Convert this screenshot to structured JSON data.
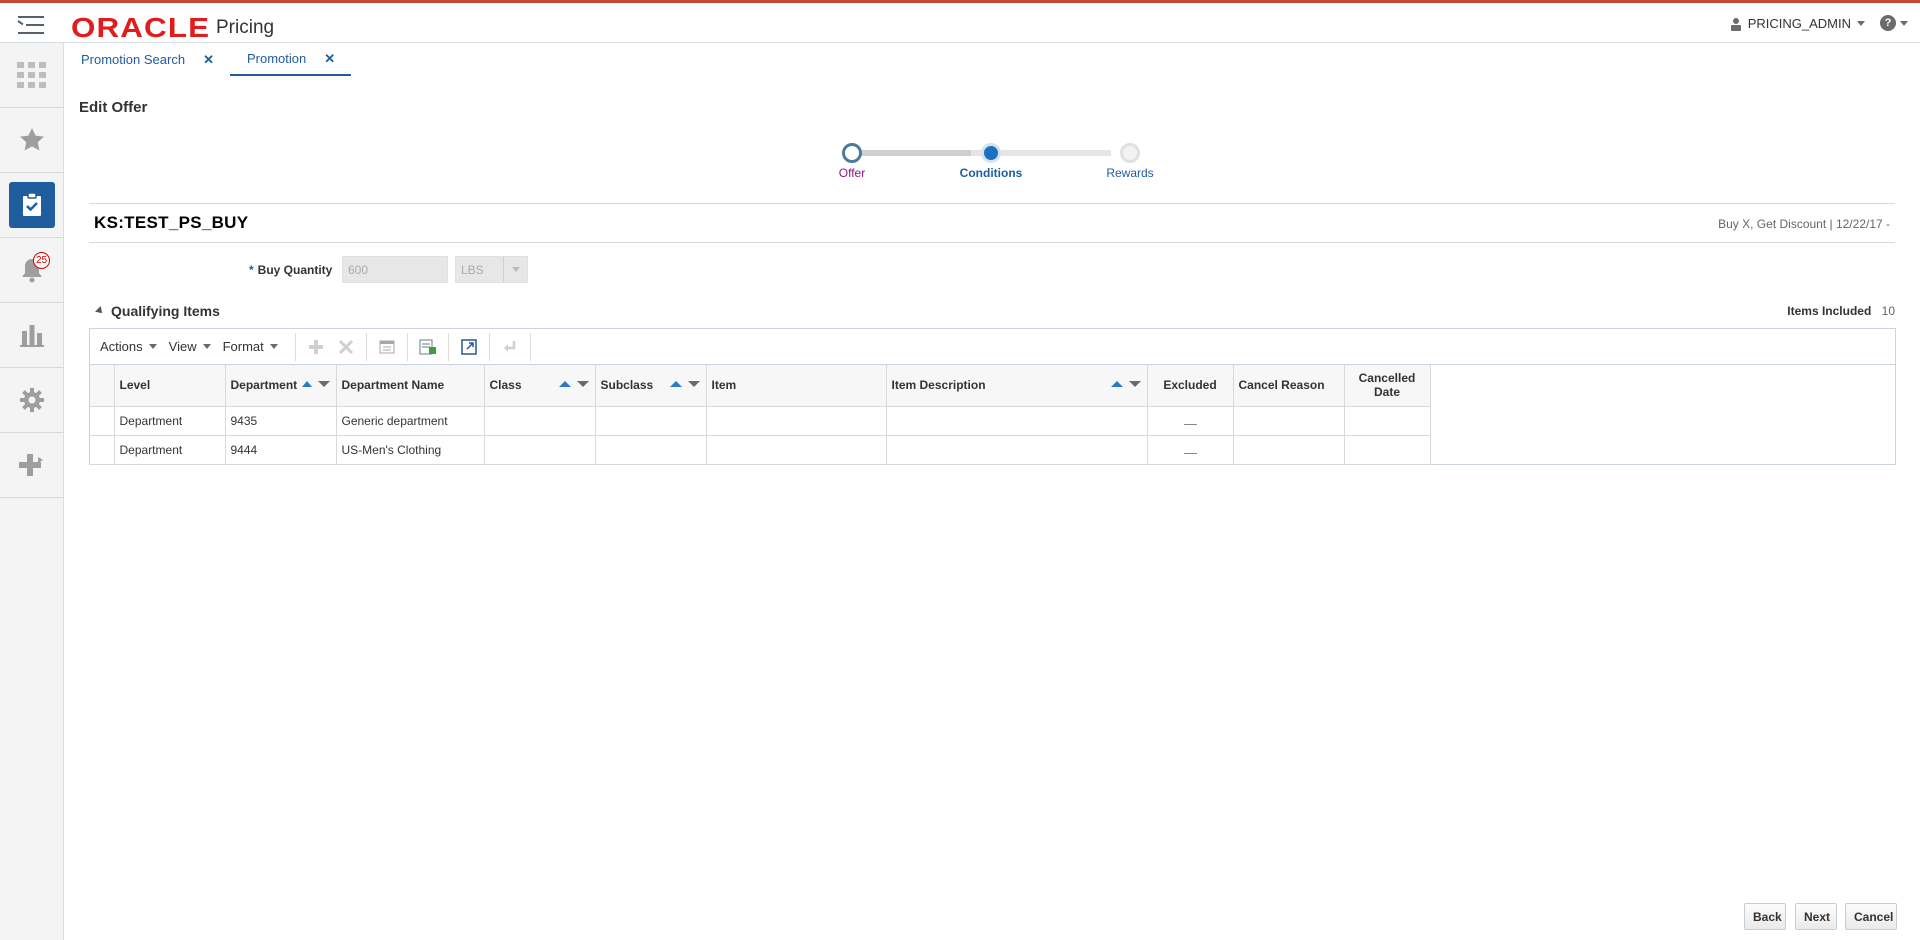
{
  "app": {
    "logo": "ORACLE",
    "product": "Pricing"
  },
  "user": {
    "name": "PRICING_ADMIN",
    "help": "?"
  },
  "nav": {
    "notifications_count": "25"
  },
  "tabs": [
    {
      "label": "Promotion Search"
    },
    {
      "label": "Promotion"
    }
  ],
  "page": {
    "title": "Edit Offer"
  },
  "train": {
    "steps": [
      {
        "label": "Offer"
      },
      {
        "label": "Conditions"
      },
      {
        "label": "Rewards"
      }
    ]
  },
  "offer": {
    "name": "KS:TEST_PS_BUY",
    "meta": "Buy X, Get Discount  |  12/22/17  -"
  },
  "buy_quantity": {
    "label": "Buy Quantity",
    "required_mark": "*",
    "value": "600",
    "uom": "LBS"
  },
  "qualifying_items": {
    "title": "Qualifying Items",
    "items_included_label": "Items Included",
    "items_included_value": "10",
    "toolbar": {
      "actions": "Actions",
      "view": "View",
      "format": "Format"
    },
    "columns": {
      "level": "Level",
      "department": "Department",
      "department_name": "Department Name",
      "class": "Class",
      "subclass": "Subclass",
      "item": "Item",
      "item_description": "Item Description",
      "excluded": "Excluded",
      "cancel_reason": "Cancel Reason",
      "cancelled_date": "Cancelled Date"
    },
    "rows": [
      {
        "level": "Department",
        "department": "9435",
        "department_name": "Generic department"
      },
      {
        "level": "Department",
        "department": "9444",
        "department_name": "US-Men's Clothing"
      }
    ]
  },
  "buttons": {
    "back": "Back",
    "next": "Next",
    "cancel": "Cancel"
  },
  "colors": {
    "brand_red": "#e01c1c",
    "accent_blue": "#1f5d9e",
    "offer_step": "#8b1a7a"
  }
}
